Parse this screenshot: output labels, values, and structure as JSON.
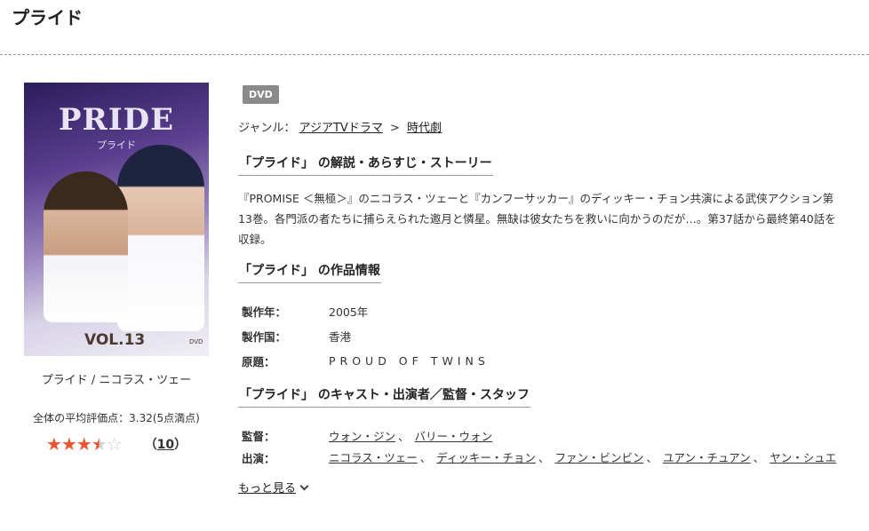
{
  "page": {
    "title": "プライド"
  },
  "left": {
    "cover": {
      "logo": "PRIDE",
      "subtitle": "プライド",
      "volume": "VOL.13",
      "dvd_mark": "DVD"
    },
    "caption": "プライド / ニコラス・ツェー",
    "rating_text": "全体の平均評価点：3.32(5点満点)",
    "rating_value": 3.32,
    "rating_max": 5,
    "review_count": "10"
  },
  "badge": "DVD",
  "genre": {
    "label": "ジャンル：",
    "item1": "アジアTVドラマ",
    "arrow": ">",
    "item2": "時代劇"
  },
  "sections": {
    "story": "「プライド」 の解説・あらすじ・ストーリー",
    "info": "「プライド」 の作品情報",
    "cast": "「プライド」 のキャスト・出演者／監督・スタッフ"
  },
  "description": "『PROMISE ＜無極＞』のニコラス・ツェーと『カンフーサッカー』のディッキー・チョン共演による武侠アクション第13巻。各門派の者たちに捕らえられた邀月と憐星。無缺は彼女たちを救いに向かうのだが…。第37話から最終第40話を収録。",
  "info": {
    "year_label": "製作年：",
    "year": "2005年",
    "country_label": "製作国：",
    "country": "香港",
    "original_label": "原題：",
    "original": "PROUD OF TWINS"
  },
  "staff": {
    "director_label": "監督：",
    "directors": [
      "ウォン・ジン",
      "バリー・ウォン"
    ],
    "cast_label": "出演：",
    "cast": [
      "ニコラス・ツェー",
      "ディッキー・チョン",
      "ファン・ビンビン",
      "ユアン・チュアン",
      "ヤン・シュエ"
    ],
    "separator": "、"
  },
  "more": "もっと見る"
}
